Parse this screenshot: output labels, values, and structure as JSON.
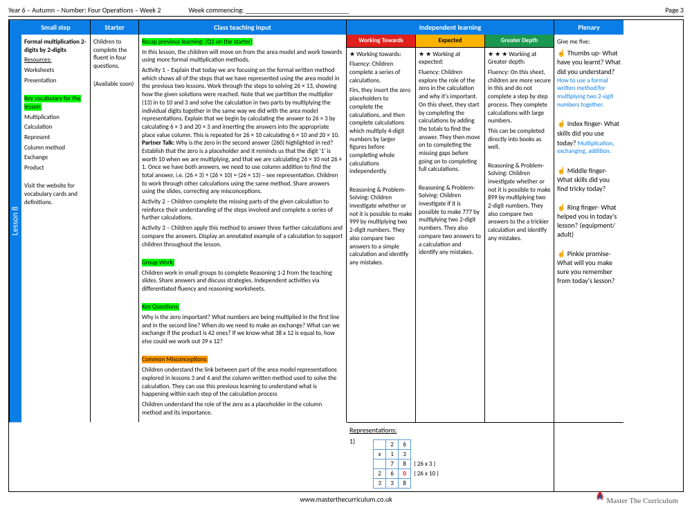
{
  "header": {
    "title": "Year 6 – Autumn – Number: Four Operations – Week 2",
    "week": "Week commencing: ______________________________",
    "page": "Page 3"
  },
  "columns": {
    "smallstep": "Small step",
    "starter": "Starter",
    "teaching": "Class teaching input",
    "independent": "Independent learning",
    "plenary": "Plenary"
  },
  "lesson_label": "Lesson 8",
  "smallstep": {
    "title": "Formal multiplication 2-digits by 2-digits",
    "res_h": "Resources:",
    "res1": "Worksheets",
    "res2": "Presentation",
    "vocab_h": "Key vocabulary for the lesson:",
    "v1": "Multiplication",
    "v2": "Calculation",
    "v3": "Represent",
    "v4": "Column method",
    "v5": "Exchange",
    "v6": "Product",
    "visit": "Visit the website for vocabulary cards and definitions."
  },
  "starter": {
    "l1": "Children to complete the fluent in four questions.",
    "l2": "(Available soon)"
  },
  "teaching": {
    "recap_h": "Recap previous learning: (Q1 on the starter)",
    "recap_body": "In this lesson, the children will move on from the area model and work towards using more formal multiplication methods.",
    "act1": "Activity 1 – Explain that today we are focusing on the formal written method which shows all of the steps that we have represented using the area model in the previous two lessons. Work through the steps to solving 26 × 13, showing how the given solutions were reached. Note that we partition the multiplier (13) in to 10 and 3 and solve the calculation in two parts by multiplying the individual digits together in the same way we did with the area model representations. Explain that we begin by calculating the answer to 26 × 3 by calculating 6 × 3 and 20 × 3 and inserting the answers into the appropriate place value column. This is repeated for 26 × 10 calculating 6 × 10 and 20 × 10. ",
    "partner_label": "Partner Talk:",
    "partner": " Why is the zero in the second answer (260) highlighted in red? Establish that the zero is a placeholder and it reminds us that the digit '1' is worth 10 when we are multiplying, and that we are calculating 26 × 10 not 26 × 1. Once we have both answers, we need to use column addition to find the total answer, i.e. (26 × 3) + (26 × 10) = (26 × 13) – see representation. Children to work through other calculations using the same method. Share answers  using the slides, correcting any misconceptions.",
    "act2": "Activity 2 – Children complete the missing parts of the given calculation to reinforce their understanding of the steps involved and complete a series of further calculations.",
    "act3": "Activity 3 – Children apply this method to answer three further calculations and compare the answers. Display an annotated example of a calculation to support children throughout the lesson.",
    "group_h": "Group Work:",
    "group": "Children work in small groups to complete Reasoning 1-2 from the teaching slides. Share answers and discuss strategies. Independent activities via differentiated fluency and reasoning worksheets.",
    "kq_h": "Key Questions:",
    "kq": "Why is the zero important? What numbers are being multiplied in the first line and in the second line? When do we need to make an exchange? What can we exchange if the product is 42 ones? If we know what 38 x 12 is equal to, how else could we work out 39 x 12?",
    "misc_h": "Common Misconceptions:",
    "misc1": "Children understand the link between part of the area model representations explored in lessons 3 and 4 and the column written method used to solve the calculation. They can use this previous learning to understand what is happening within each step of the calculation process",
    "misc2": "Children understand the role of the zero  as a placeholder in the column method and its importance."
  },
  "il": {
    "wt_h": "Working Towards",
    "exp_h": "Expected",
    "gd_h": "Greater Depth",
    "wt_star": "★   Working towards:",
    "wt_f": "Fluency: Children complete a series of calculations.",
    "wt_f2": "Firs, they insert the zero placeholders to complete the calculations, and then complete calculations which multiply 4-digit numbers by larger figures before completing whole calculations independently.",
    "wt_rps": "Reasoning & Problem-Solving: Children investigate whether or not it is possible to make 999 by multiplying two 2-digit numbers. They also compare two answers to a simple calculation and identify any mistakes.",
    "exp_star": "★ ★  Working at expected:",
    "exp_f": "Fluency: Children explore the role of the zero in the calculation and why it's important. On this sheet, they start by completing the calculations by adding the totals to find the answer. They then move on to completing the missing gaps before going on to completing full calculations.",
    "exp_rps": "Reasoning & Problem-Solving: Children investigate if it is possible to make 777 by multiplying two 2-digit numbers. They also compare two answers to a calculation and identify any mistakes.",
    "gd_star": "★ ★ ★  Working at Greater depth:",
    "gd_f": "Fluency: On this sheet, children are more secure in this and do not complete a step by step process. They complete calculations with large numbers.",
    "gd_f2": "This can be completed directly into books as well.",
    "gd_rps": "Reasoning & Problem-Solving: Children investigate whether or not it is possible to make 899 by multiplying two 2-digit numbers. They also compare two answers to the a trickier calculation and identify any mistakes.",
    "reps_h": "Representations:",
    "reps_n": "1)"
  },
  "calc": {
    "r1c2": "2",
    "r1c3": "6",
    "r2c1": "x",
    "r2c2": "1",
    "r2c3": "3",
    "r3c2": "7",
    "r3c3": "8",
    "r3note": "( 26 x 3 )",
    "r4c1": "2",
    "r4c2": "6",
    "r4c3": "0",
    "r4note": "( 26 x 10 )",
    "r5c1": "3",
    "r5c2": "3",
    "r5c3": "8"
  },
  "plenary": {
    "intro": "Give me five:",
    "thumb": "☝ Thumbs up- What have you learnt? What did you understand?",
    "thumb_link": "How to use a formal written method for multiplying two 2-sigit numbers together.",
    "index": "☝ Index finger- What skills did you use today?",
    "index_link": "Multiplication, exchanging, addition.",
    "middle": "☝ Middle finger- What skills did you find tricky today?",
    "ring": "☝ Ring finger- What helped you in today's lesson? (equipment/ adult)",
    "pinkie": "☝ Pinkie promise- What will you make sure you remember from today's lesson?"
  },
  "footer": {
    "url": "www.masterthecurriculum.co.uk",
    "brand": "Master The Curriculum"
  }
}
